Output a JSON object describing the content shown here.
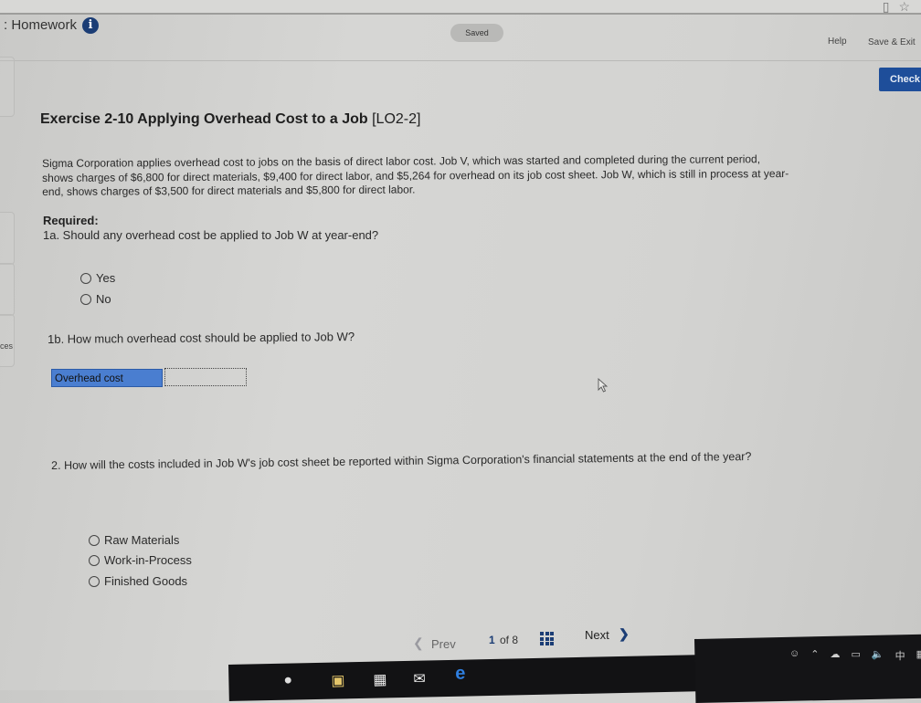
{
  "browser": {
    "icons": [
      "reader-view-icon",
      "bookmark-star-icon"
    ]
  },
  "header": {
    "title": ": Homework",
    "info_icon": "info-icon",
    "saved_status": "Saved",
    "help_label": "Help",
    "save_exit_label": "Save & Exit",
    "check_label": "Check"
  },
  "sidebar": {
    "partial_label": "ces"
  },
  "exercise": {
    "title": "Exercise 2-10 Applying Overhead Cost to a Job",
    "learning_objective": "[LO2-2]",
    "paragraph": "Sigma Corporation applies overhead cost to jobs on the basis of direct labor cost. Job V, which was started and completed during the current period, shows charges of $6,800 for direct materials, $9,400 for direct labor, and $5,264 for overhead on its job cost sheet. Job W, which is still in process at year-end, shows charges of $3,500 for direct materials and $5,800 for direct labor.",
    "required_label": "Required:",
    "q1a": {
      "text": "1a. Should any overhead cost be applied to Job W at year-end?",
      "options": [
        "Yes",
        "No"
      ],
      "selected": null
    },
    "q1b": {
      "text": "1b. How much overhead cost should be applied to Job W?",
      "input_label": "Overhead cost",
      "input_value": ""
    },
    "q2": {
      "text": "2. How will the costs included in Job W's job cost sheet be reported within Sigma Corporation's financial statements at the end of the year?",
      "options": [
        "Raw Materials",
        "Work-in-Process",
        "Finished Goods"
      ],
      "selected": null
    }
  },
  "pagination": {
    "prev_label": "Prev",
    "current_page": "1",
    "of_text": "of 8",
    "next_label": "Next"
  },
  "taskbar": {
    "apps": [
      "cortana-icon",
      "file-explorer-icon",
      "store-icon",
      "mail-icon",
      "edge-browser-icon"
    ],
    "tray": [
      "people-icon",
      "show-hidden-icons-chevron",
      "onedrive-icon",
      "network-icon",
      "volume-icon",
      "ime-chinese-icon",
      "input-mode-icon"
    ],
    "ime_label": "中"
  },
  "colors": {
    "brand_blue": "#1b3d75",
    "check_button": "#1e4e9a",
    "overhead_label_bg": "#4a7ed0"
  }
}
